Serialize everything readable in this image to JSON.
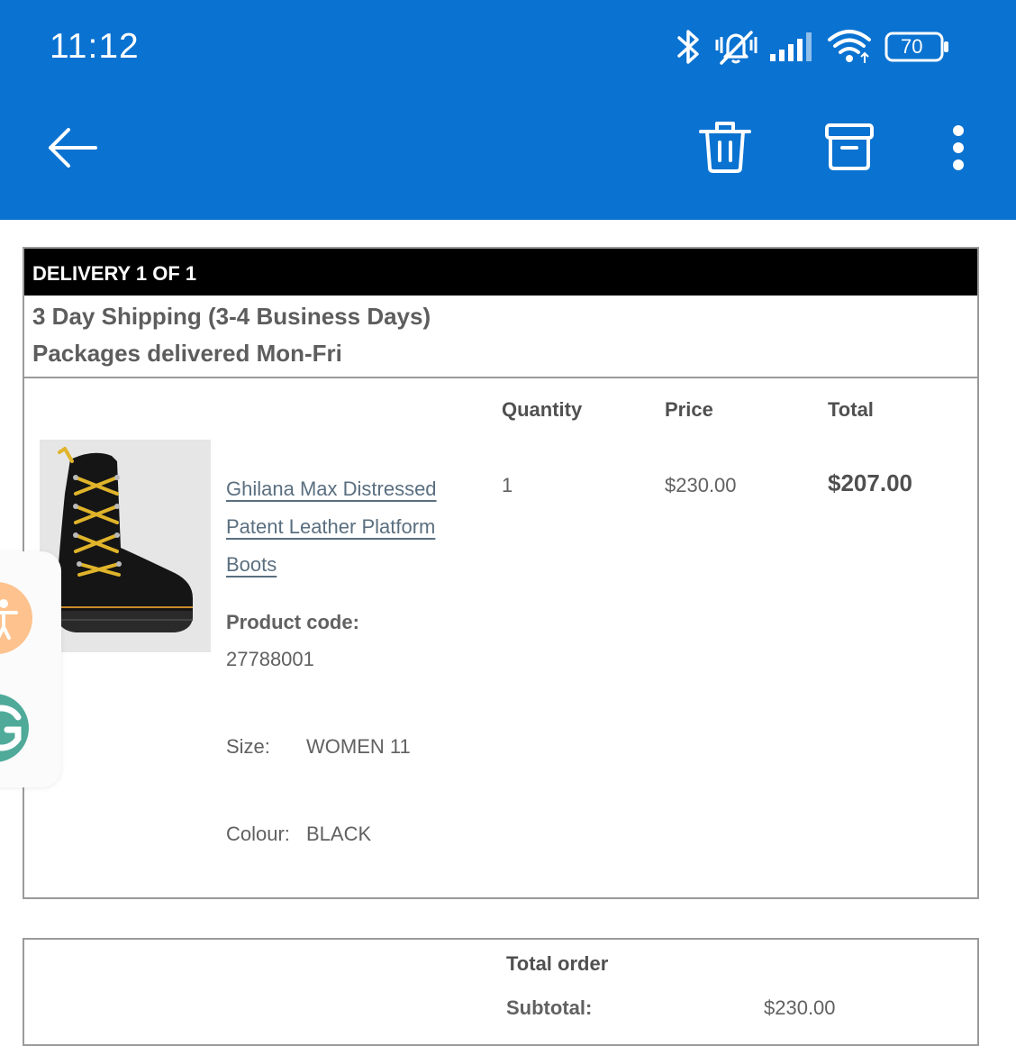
{
  "status_bar": {
    "time": "11:12",
    "battery": "70",
    "icons": [
      "bluetooth-icon",
      "vibrate-mute-icon",
      "signal-icon",
      "wifi-icon",
      "battery-icon"
    ]
  },
  "toolbar": {
    "back_icon": "arrow-left-icon",
    "delete_icon": "trash-icon",
    "archive_icon": "archive-icon",
    "more_icon": "more-vertical-icon"
  },
  "delivery": {
    "header": "DELIVERY 1 OF 1",
    "shipping_method": "3 Day Shipping (3-4 Business Days)",
    "delivery_days": "Packages delivered Mon-Fri",
    "columns": {
      "quantity": "Quantity",
      "price": "Price",
      "total": "Total"
    },
    "item": {
      "name": "Ghilana Max Distressed Patent Leather Platform Boots",
      "quantity": "1",
      "price": "$230.00",
      "total": "$207.00",
      "product_code_label": "Product code:",
      "product_code": "27788001",
      "size_label": "Size:",
      "size": "WOMEN 11",
      "colour_label": "Colour:",
      "colour": "BLACK"
    }
  },
  "order_total": {
    "title": "Total order",
    "subtotal_label": "Subtotal:",
    "subtotal": "$230.00"
  },
  "colors": {
    "app_bar": "#0a72d1",
    "header_bg": "#000000",
    "link": "#5a6f80"
  }
}
